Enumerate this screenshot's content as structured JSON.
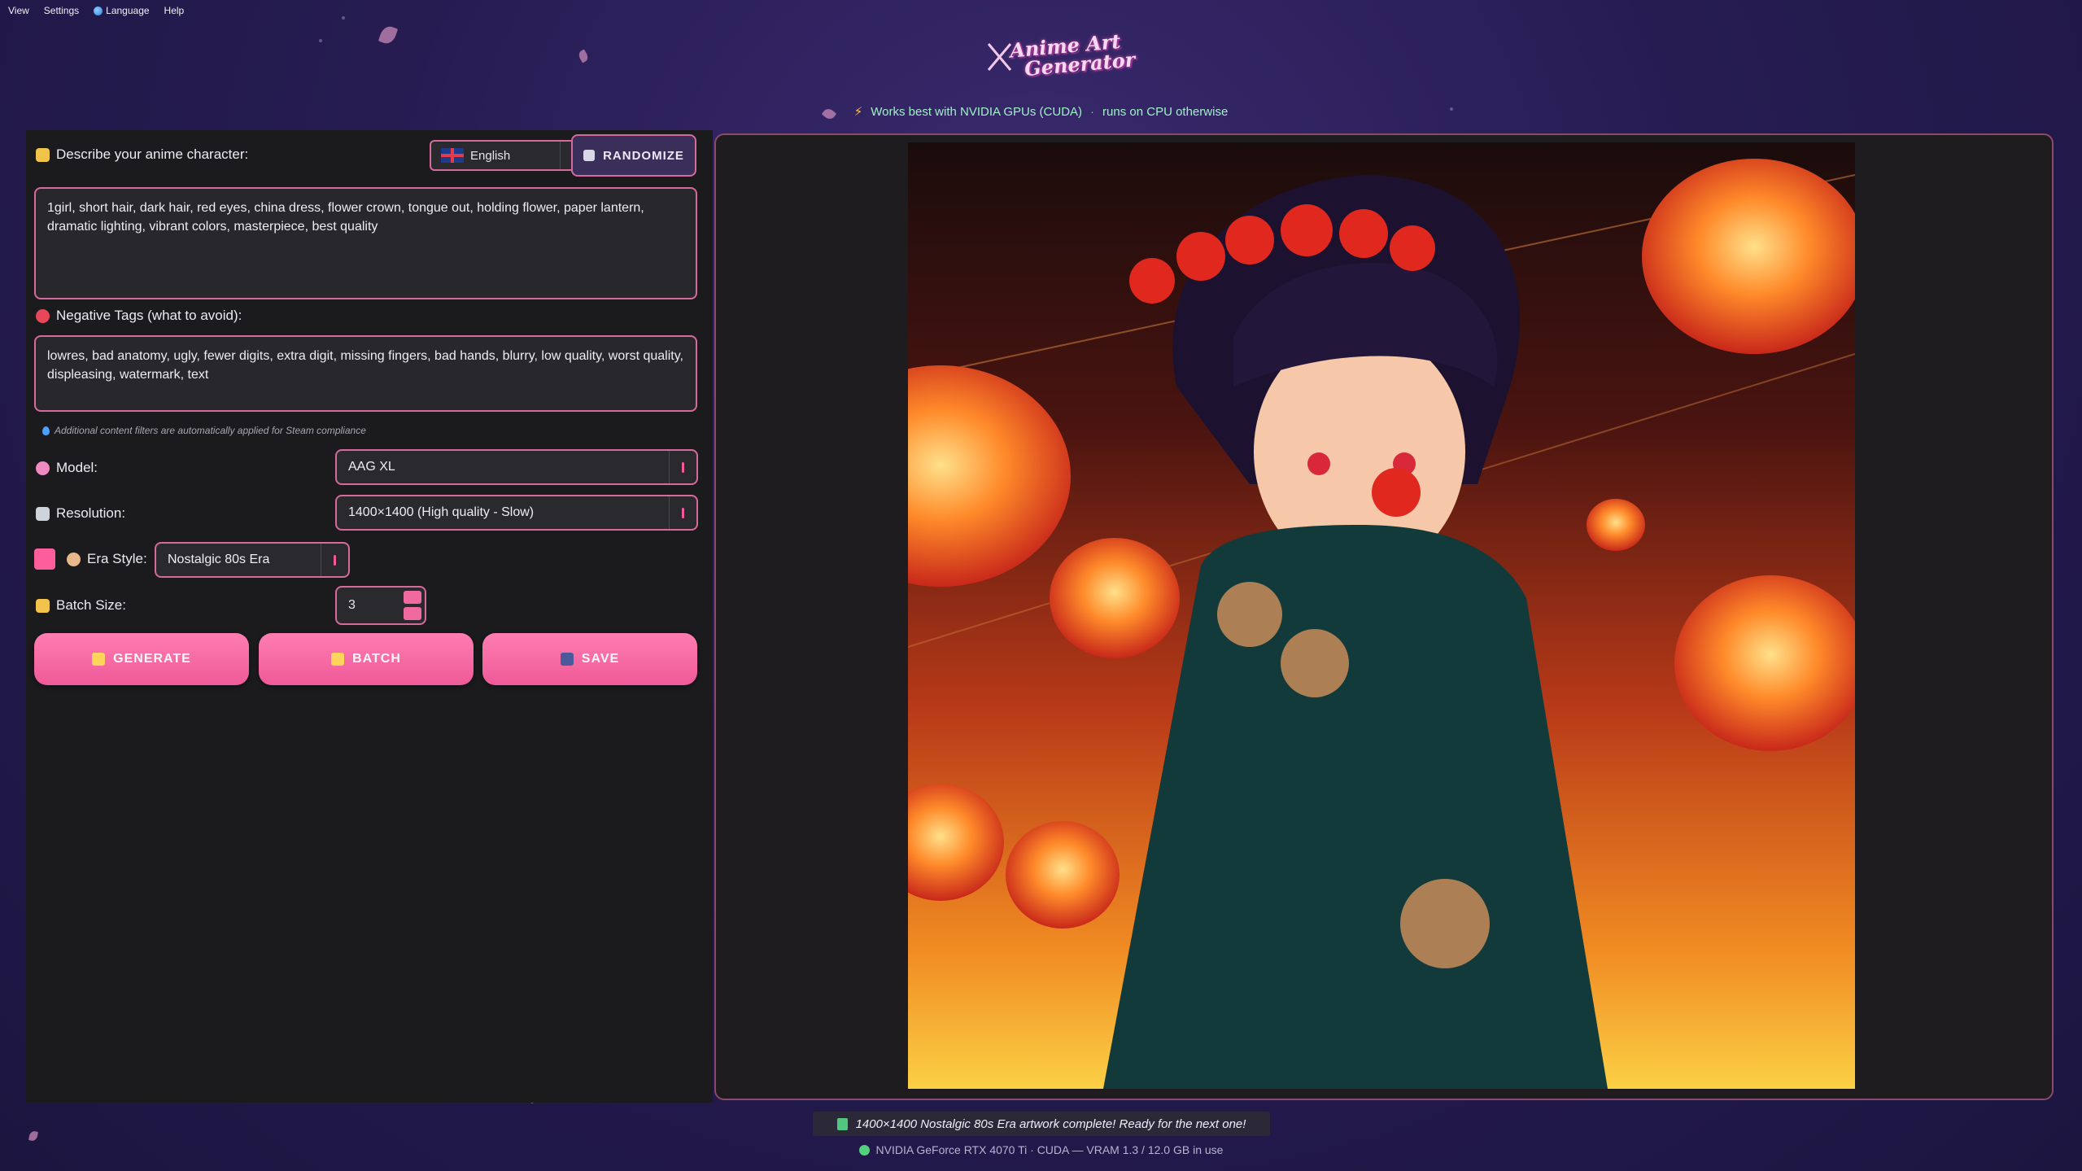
{
  "menubar": {
    "view": "View",
    "settings": "Settings",
    "language": "Language",
    "help": "Help"
  },
  "header": {
    "logo_line1": "Anime Art",
    "logo_line2": "Generator",
    "notice_primary": "Works best with NVIDIA GPUs (CUDA)",
    "notice_separator": "·",
    "notice_secondary": "runs on CPU otherwise"
  },
  "prompt": {
    "label": "Describe your anime character:",
    "value": "1girl, short hair, dark hair, red eyes, china dress, flower crown, tongue out, holding flower, paper lantern, dramatic lighting, vibrant colors, masterpiece, best quality"
  },
  "language_select": {
    "value": "English"
  },
  "randomize_button": {
    "label": "RANDOMIZE"
  },
  "negative": {
    "label": "Negative Tags (what to avoid):",
    "value": "lowres, bad anatomy, ugly, fewer digits, extra digit, missing fingers, bad hands, blurry, low quality, worst quality, displeasing, watermark, text"
  },
  "hint": "Additional content filters are automatically applied for Steam compliance",
  "model": {
    "label": "Model:",
    "value": "AAG XL"
  },
  "resolution": {
    "label": "Resolution:",
    "value": "1400×1400 (High quality - Slow)"
  },
  "era": {
    "label": "Era Style:",
    "value": "Nostalgic 80s Era",
    "swatch_color": "#ff5e9c"
  },
  "batch_size": {
    "label": "Batch Size:",
    "value": "3"
  },
  "actions": {
    "generate": "GENERATE",
    "batch": "BATCH",
    "save": "SAVE"
  },
  "status": {
    "message": "1400×1400 Nostalgic 80s Era artwork complete! Ready for the next one!"
  },
  "gpu": {
    "info": "NVIDIA GeForce RTX 4070 Ti · CUDA — VRAM 1.3 / 12.0 GB in use"
  },
  "colors": {
    "accent": "#f06aa0",
    "border": "#d66a9a",
    "panel": "#1b1a1d",
    "notice": "#9ff0c6"
  }
}
